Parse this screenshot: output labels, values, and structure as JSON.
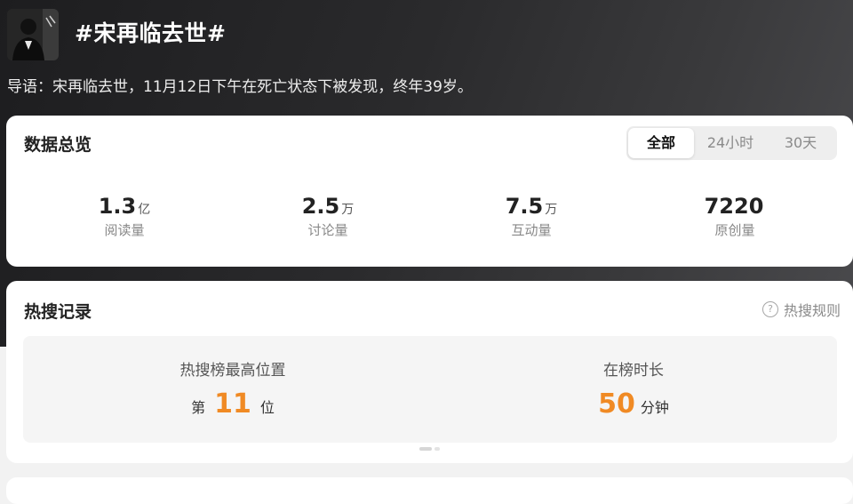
{
  "topic": {
    "title": "#宋再临去世#",
    "intro": "导语：宋再临去世，11月12日下午在死亡状态下被发现，终年39岁。"
  },
  "overview": {
    "title": "数据总览",
    "tabs": [
      {
        "label": "全部",
        "active": true
      },
      {
        "label": "24小时",
        "active": false
      },
      {
        "label": "30天",
        "active": false
      }
    ],
    "stats": [
      {
        "value": "1.3",
        "unit": "亿",
        "label": "阅读量"
      },
      {
        "value": "2.5",
        "unit": "万",
        "label": "讨论量"
      },
      {
        "value": "7.5",
        "unit": "万",
        "label": "互动量"
      },
      {
        "value": "7220",
        "unit": "",
        "label": "原创量"
      }
    ]
  },
  "hot_search": {
    "title": "热搜记录",
    "rules_label": "热搜规则",
    "peak": {
      "label": "热搜榜最高位置",
      "prefix": "第",
      "value": "11",
      "suffix": "位"
    },
    "duration": {
      "label": "在榜时长",
      "value": "50",
      "unit": "分钟"
    }
  },
  "colors": {
    "accent": "#f08a24",
    "hero_bg": "#1d1d1f"
  },
  "icons": {
    "rules": "question-circle-icon"
  }
}
